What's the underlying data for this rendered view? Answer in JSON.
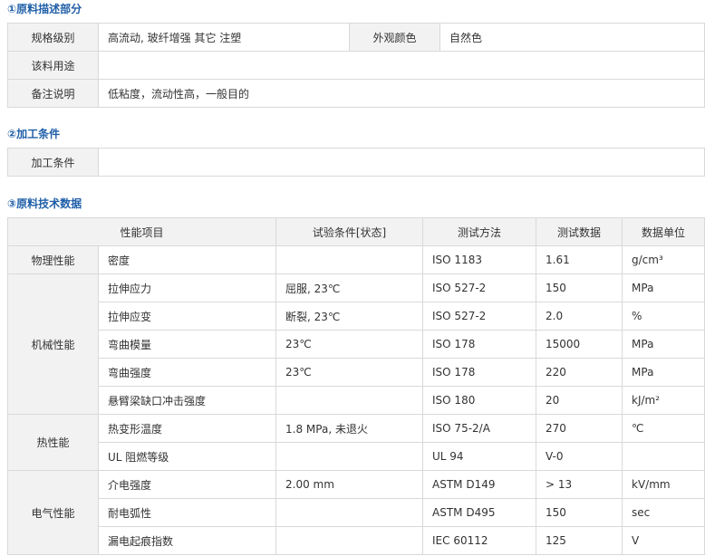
{
  "section1": {
    "title": "①原料描述部分",
    "spec_label": "规格级别",
    "spec_value": "高流动, 玻纤增强 其它 注塑",
    "color_label": "外观颜色",
    "color_value": "自然色",
    "usage_label": "该料用途",
    "usage_value": "",
    "note_label": "备注说明",
    "note_value": "低粘度，流动性高，一般目的"
  },
  "section2": {
    "title": "②加工条件",
    "label": "加工条件",
    "value": ""
  },
  "section3": {
    "title": "③原料技术数据",
    "headers": [
      "性能项目",
      "试验条件[状态]",
      "测试方法",
      "测试数据",
      "数据单位"
    ],
    "groups": [
      {
        "category": "物理性能",
        "rows": [
          {
            "item": "密度",
            "condition": "",
            "method": "ISO 1183",
            "value": "1.61",
            "unit": "g/cm³"
          }
        ]
      },
      {
        "category": "机械性能",
        "rows": [
          {
            "item": "拉伸应力",
            "condition": "屈服, 23℃",
            "method": "ISO 527-2",
            "value": "150",
            "unit": "MPa"
          },
          {
            "item": "拉伸应变",
            "condition": "断裂, 23℃",
            "method": "ISO 527-2",
            "value": "2.0",
            "unit": "%"
          },
          {
            "item": "弯曲模量",
            "condition": "23℃",
            "method": "ISO 178",
            "value": "15000",
            "unit": "MPa"
          },
          {
            "item": "弯曲强度",
            "condition": "23℃",
            "method": "ISO 178",
            "value": "220",
            "unit": "MPa"
          },
          {
            "item": "悬臂梁缺口冲击强度",
            "condition": "",
            "method": "ISO 180",
            "value": "20",
            "unit": "kJ/m²"
          }
        ]
      },
      {
        "category": "热性能",
        "rows": [
          {
            "item": "热变形温度",
            "condition": "1.8 MPa, 未退火",
            "method": "ISO 75-2/A",
            "value": "270",
            "unit": "℃"
          },
          {
            "item": "UL 阻燃等级",
            "condition": "",
            "method": "UL 94",
            "value": "V-0",
            "unit": ""
          }
        ]
      },
      {
        "category": "电气性能",
        "rows": [
          {
            "item": "介电强度",
            "condition": "2.00 mm",
            "method": "ASTM D149",
            "value": "> 13",
            "unit": "kV/mm"
          },
          {
            "item": "耐电弧性",
            "condition": "",
            "method": "ASTM D495",
            "value": "150",
            "unit": "sec"
          },
          {
            "item": "漏电起痕指数",
            "condition": "",
            "method": "IEC 60112",
            "value": "125",
            "unit": "V"
          }
        ]
      }
    ]
  }
}
